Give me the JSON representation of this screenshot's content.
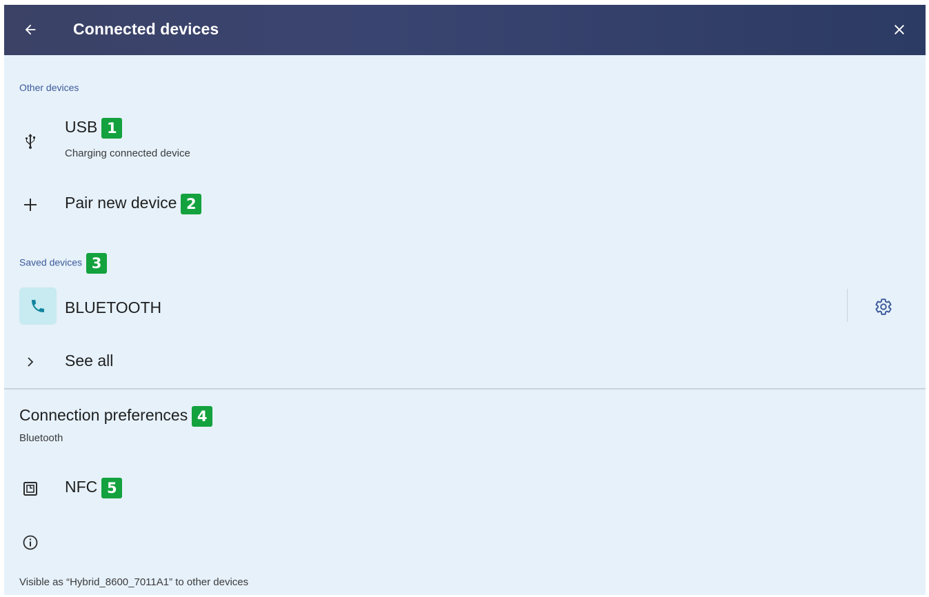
{
  "appbar": {
    "title": "Connected devices",
    "back_icon": "arrow-back-icon",
    "close_icon": "close-icon"
  },
  "other_devices": {
    "header": "Other devices",
    "usb": {
      "label": "USB",
      "sublabel": "Charging connected device",
      "icon": "usb-icon",
      "badge": "1"
    },
    "pair": {
      "label": "Pair new device",
      "icon": "plus-icon",
      "badge": "2"
    }
  },
  "saved_devices": {
    "header": "Saved devices",
    "badge": "3",
    "device": {
      "label": "BLUETOOTH",
      "icon": "phone-icon",
      "settings_icon": "gear-icon"
    },
    "see_all": {
      "label": "See all",
      "icon": "chevron-right-icon"
    }
  },
  "connection_preferences": {
    "label": "Connection preferences",
    "sublabel": "Bluetooth",
    "badge": "4"
  },
  "nfc": {
    "label": "NFC",
    "icon": "nfc-icon",
    "badge": "5"
  },
  "info": {
    "icon": "info-icon",
    "text": "Visible as “Hybrid_8600_7011A1” to other devices"
  },
  "colors": {
    "appbar": "#3a4470",
    "background": "#e6f1fa",
    "section_header": "#3c5a99",
    "badge": "#13a23e",
    "bt_tile": "#c8eaf1",
    "phone_icon": "#13859e"
  }
}
